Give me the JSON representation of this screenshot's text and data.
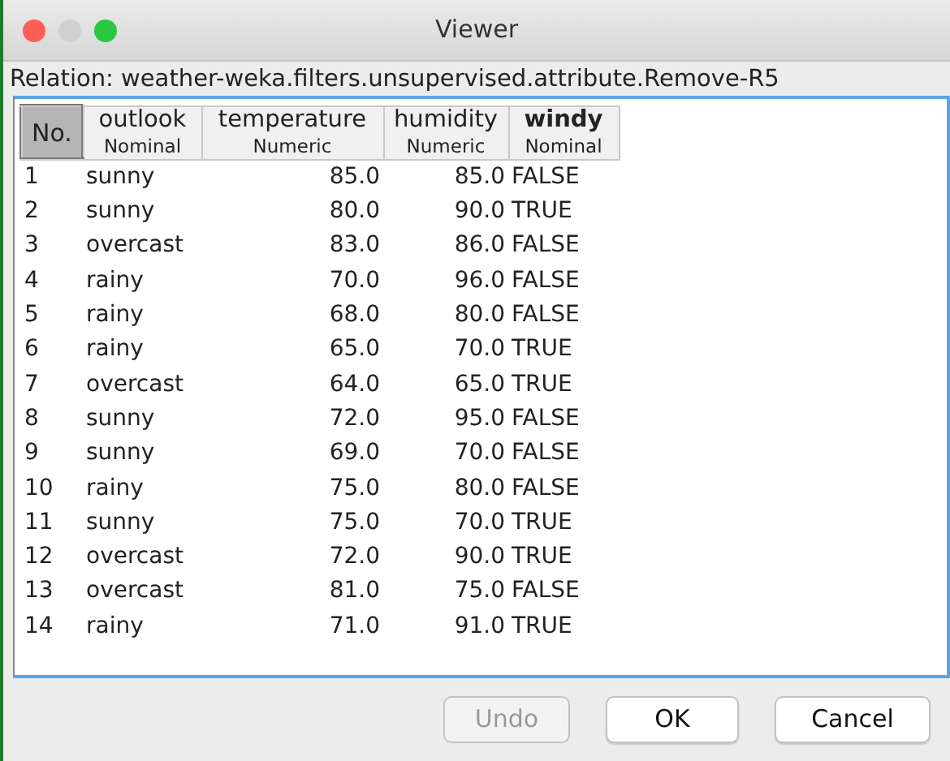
{
  "window": {
    "title": "Viewer"
  },
  "relation": "Relation: weather-weka.filters.unsupervised.attribute.Remove-R5",
  "table": {
    "columns": [
      {
        "kind": "index",
        "name": "No."
      },
      {
        "kind": "nominal",
        "name": "outlook",
        "type": "Nominal",
        "selected": false
      },
      {
        "kind": "numeric",
        "name": "temperature",
        "type": "Numeric",
        "selected": false
      },
      {
        "kind": "numeric",
        "name": "humidity",
        "type": "Numeric",
        "selected": false
      },
      {
        "kind": "nominal",
        "name": "windy",
        "type": "Nominal",
        "selected": true
      }
    ],
    "rows": [
      [
        "1",
        "sunny",
        "85.0",
        "85.0",
        "FALSE"
      ],
      [
        "2",
        "sunny",
        "80.0",
        "90.0",
        "TRUE"
      ],
      [
        "3",
        "overcast",
        "83.0",
        "86.0",
        "FALSE"
      ],
      [
        "4",
        "rainy",
        "70.0",
        "96.0",
        "FALSE"
      ],
      [
        "5",
        "rainy",
        "68.0",
        "80.0",
        "FALSE"
      ],
      [
        "6",
        "rainy",
        "65.0",
        "70.0",
        "TRUE"
      ],
      [
        "7",
        "overcast",
        "64.0",
        "65.0",
        "TRUE"
      ],
      [
        "8",
        "sunny",
        "72.0",
        "95.0",
        "FALSE"
      ],
      [
        "9",
        "sunny",
        "69.0",
        "70.0",
        "FALSE"
      ],
      [
        "10",
        "rainy",
        "75.0",
        "80.0",
        "FALSE"
      ],
      [
        "11",
        "sunny",
        "75.0",
        "70.0",
        "TRUE"
      ],
      [
        "12",
        "overcast",
        "72.0",
        "90.0",
        "TRUE"
      ],
      [
        "13",
        "overcast",
        "81.0",
        "75.0",
        "FALSE"
      ],
      [
        "14",
        "rainy",
        "71.0",
        "91.0",
        "TRUE"
      ]
    ]
  },
  "buttons": [
    {
      "label": "Undo",
      "disabled": true
    },
    {
      "label": "OK",
      "disabled": false
    },
    {
      "label": "Cancel",
      "disabled": false
    }
  ]
}
